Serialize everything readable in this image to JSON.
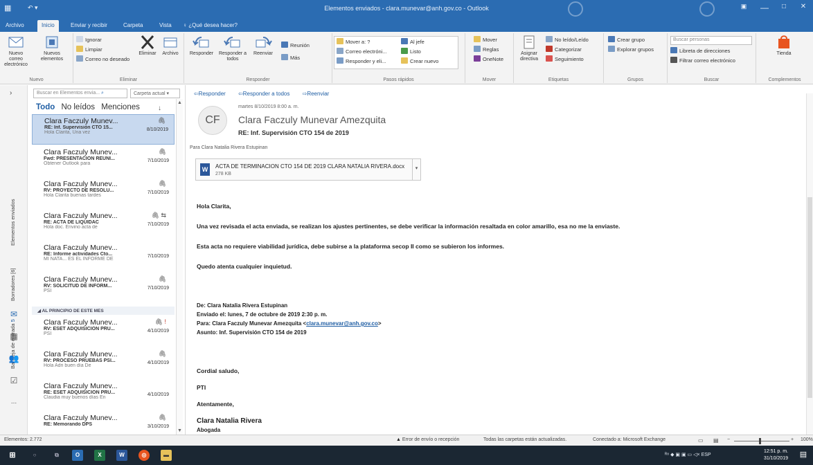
{
  "window": {
    "title": "Elementos enviados - clara.munevar@anh.gov.co  -  Outlook",
    "minimize": "—",
    "maximize": "□",
    "close": "✕"
  },
  "tabs": [
    "Archivo",
    "Inicio",
    "Enviar y recibir",
    "Carpeta",
    "Vista",
    "¿Qué desea hacer?"
  ],
  "ribbon": {
    "nuevo": {
      "new_mail": "Nuevo correo electrónico",
      "new_items": "Nuevos elementos",
      "label": "Nuevo"
    },
    "eliminar": {
      "ignore": "Ignorar",
      "clean": "Limpiar",
      "junk": "Correo no deseado",
      "delete": "Eliminar",
      "archive": "Archivo",
      "label": "Eliminar"
    },
    "responder": {
      "reply": "Responder",
      "reply_all": "Responder a todos",
      "forward": "Reenviar",
      "meeting": "Reunión",
      "more": "Más",
      "label": "Responder"
    },
    "pasos": {
      "move_to": "Mover a: ?",
      "to_boss": "Al jefe",
      "email": "Correo electróni...",
      "done": "Listo",
      "reply_delete": "Responder y eli...",
      "create_new": "Crear nuevo",
      "label": "Pasos rápidos"
    },
    "mover": {
      "move": "Mover",
      "rules": "Reglas",
      "onenote": "OneNote",
      "label": "Mover"
    },
    "etiquetas": {
      "assign_policy": "Asignar directiva",
      "unread": "No leído/Leído",
      "categorize": "Categorizar",
      "followup": "Seguimiento",
      "label": "Etiquetas"
    },
    "grupos": {
      "create": "Crear grupo",
      "explore": "Explorar grupos",
      "label": "Grupos"
    },
    "buscar": {
      "search_people": "Buscar personas",
      "address_book": "Libreta de direcciones",
      "filter": "Filtrar correo electrónico",
      "label": "Buscar"
    },
    "complementos": {
      "store": "Tienda",
      "label": "Complementos"
    }
  },
  "rail": {
    "sent": "Elementos enviados",
    "drafts": "Borradores [6]",
    "inbox": "Bandeja de entrada",
    "inbox_count": "5",
    "expand": "›",
    "more": "..."
  },
  "list": {
    "search_placeholder": "Buscar en Elementos envia...",
    "scope": "Carpeta actual",
    "filters": [
      "Todo",
      "No leídos",
      "Menciones"
    ],
    "sort": "↓",
    "group_header": "AL PRINCIPIO DE ESTE MES",
    "items": [
      {
        "from": "Clara Faczuly Munev...",
        "subject": "RE: Inf. Supervisión CTO 15...",
        "preview": "Hola Clarita,  Una vez",
        "date": "8/10/2019",
        "ind": "🖇"
      },
      {
        "from": "Clara Faczuly Munev...",
        "subject": "Fwd: PRESENTACION REUNI...",
        "preview": "Obtener Outlook para",
        "date": "7/10/2019",
        "ind": "🖇"
      },
      {
        "from": "Clara Faczuly Munev...",
        "subject": "RV: PROYECTO DE RESOLU...",
        "preview": "Hola Clarita buenas tardes",
        "date": "7/10/2019",
        "ind": "🖇"
      },
      {
        "from": "Clara Faczuly Munev...",
        "subject": "RE: ACTA DE LIQUIDAC",
        "preview": "Hola doc.  Envino acta de",
        "date": "7/10/2019",
        "ind": "🖇 ⇆"
      },
      {
        "from": "Clara Faczuly Munev...",
        "subject": "RE: Informe actividades Cto...",
        "preview": "MI NATA... ES EL INFORME DE",
        "date": "7/10/2019",
        "ind": ""
      },
      {
        "from": "Clara Faczuly Munev...",
        "subject": "RV: SOLICITUD DE INFORM...",
        "preview": "PSI",
        "date": "7/10/2019",
        "ind": "🖇"
      },
      {
        "from": "Clara Faczuly Munev...",
        "subject": "RV: ESET ADQUISICIÓN PRU...",
        "preview": "PSI",
        "date": "4/10/2019",
        "ind": "🖇",
        "flag": "!"
      },
      {
        "from": "Clara Faczuly Munev...",
        "subject": "RV: PROCESO PRUEBAS PSI...",
        "preview": "Hola Adri buen día  De",
        "date": "4/10/2019",
        "ind": "🖇"
      },
      {
        "from": "Clara Faczuly Munev...",
        "subject": "RE: ESET ADQUISICIÓN PRU...",
        "preview": "Claudia muy buenos días  En",
        "date": "4/10/2019",
        "ind": ""
      },
      {
        "from": "Clara Faczuly Munev...",
        "subject": "RE: Memorando DPS",
        "preview": "",
        "date": "3/10/2019",
        "ind": "🖇"
      }
    ]
  },
  "reading": {
    "actions": [
      "Responder",
      "Responder a todos",
      "Reenviar"
    ],
    "initials": "CF",
    "date": "martes 8/10/2019 8:00 a. m.",
    "from": "Clara Faczuly Munevar Amezquita",
    "subject": "RE: Inf. Supervisión CTO 154 de 2019",
    "to": "Para   Clara Natalia Rivera Estupinan",
    "attachment_name": "ACTA DE TERMINACION CTO 154 DE 2019 CLARA NATALIA RIVERA.docx",
    "attachment_size": "278 KB",
    "greeting": "Hola Clarita,",
    "p1": "Una vez revisada el acta enviada, se realizan los ajustes pertinentes, se debe verificar la información resaltada en color amarillo, esa no me la enviaste.",
    "p2": "Esta acta no requiere viabilidad jurídica, debe subirse a la plataforma secop II como se subieron los informes.",
    "p3": "Quedo atenta  cualquier inquietud.",
    "q_from": "De: Clara Natalia Rivera Estupinan",
    "q_sent": "Enviado el: lunes, 7 de octubre de 2019 2:30 p. m.",
    "q_to_prefix": "Para: Clara Faczuly Munevar Amezquita <",
    "q_to_email": "clara.munevar@anh.gov.co",
    "q_to_suffix": ">",
    "q_subject": "Asunto: Inf. Supervisión CTO 154 de 2019",
    "cordial": "Cordial saludo,",
    "pti": "PTI",
    "atentamente": "Atentamente,",
    "signature": "Clara Natalia Rivera",
    "signature2": "Abogada"
  },
  "status": {
    "items": "Elementos: 2.772",
    "error": "Error de envío o recepción",
    "folders": "Todas las carpetas están actualizadas.",
    "connected": "Conectado a: Microsoft Exchange",
    "zoom": "100%",
    "zoom_level": 0.45
  },
  "taskbar": {
    "time": "12:51 p. m.",
    "date": "31/10/2019",
    "lang": "ESP"
  },
  "colors": {
    "accent": "#2b6cb2",
    "selected": "#c8d9ef",
    "link": "#1e5da3",
    "taskbar": "#1b2733"
  }
}
